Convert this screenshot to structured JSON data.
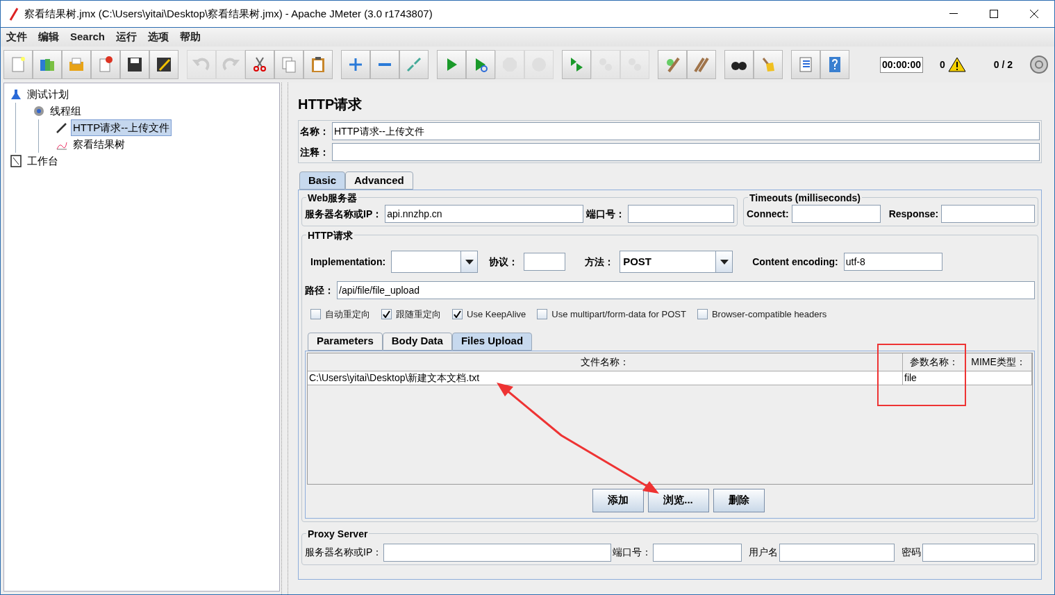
{
  "window": {
    "title": "察看结果树.jmx (C:\\Users\\yitai\\Desktop\\察看结果树.jmx) - Apache JMeter (3.0 r1743807)"
  },
  "menu": [
    "文件",
    "编辑",
    "Search",
    "运行",
    "选项",
    "帮助"
  ],
  "toolbar": [
    [
      {
        "kind": "new",
        "disabled": false
      },
      {
        "kind": "templates",
        "disabled": false
      },
      {
        "kind": "open",
        "disabled": false
      },
      {
        "kind": "close",
        "disabled": false
      },
      {
        "kind": "save",
        "disabled": false
      },
      {
        "kind": "save-as",
        "disabled": false
      }
    ],
    [
      {
        "kind": "undo",
        "disabled": true
      },
      {
        "kind": "redo",
        "disabled": true
      },
      {
        "kind": "cut",
        "disabled": false
      },
      {
        "kind": "copy",
        "disabled": false
      },
      {
        "kind": "paste",
        "disabled": false
      }
    ],
    [
      {
        "kind": "expand",
        "disabled": false
      },
      {
        "kind": "collapse",
        "disabled": false
      },
      {
        "kind": "toggle",
        "disabled": false
      }
    ],
    [
      {
        "kind": "start",
        "disabled": false
      },
      {
        "kind": "start-no-pause",
        "disabled": false
      },
      {
        "kind": "stop",
        "disabled": true
      },
      {
        "kind": "shutdown",
        "disabled": true
      }
    ],
    [
      {
        "kind": "remote-start",
        "disabled": false
      },
      {
        "kind": "remote-stop",
        "disabled": true
      },
      {
        "kind": "remote-shutdown",
        "disabled": true
      }
    ],
    [
      {
        "kind": "clear",
        "disabled": false
      },
      {
        "kind": "clear-all",
        "disabled": false
      }
    ],
    [
      {
        "kind": "search",
        "disabled": false
      },
      {
        "kind": "reset-search",
        "disabled": false
      }
    ],
    [
      {
        "kind": "function-helper",
        "disabled": false
      },
      {
        "kind": "help",
        "disabled": false
      }
    ]
  ],
  "status": {
    "timer": "00:00:00",
    "warnings": "0",
    "threads": "0 / 2"
  },
  "tree": [
    {
      "label": "测试计划",
      "kind": "plan",
      "selected": false,
      "children": [
        {
          "label": "线程组",
          "kind": "threads",
          "selected": false,
          "children": [
            {
              "label": "HTTP请求--上传文件",
              "kind": "sampler",
              "selected": true
            },
            {
              "label": "察看结果树",
              "kind": "listener",
              "selected": false
            }
          ]
        }
      ]
    },
    {
      "label": "工作台",
      "kind": "workbench",
      "selected": false
    }
  ],
  "editor": {
    "title": "HTTP请求",
    "name_label": "名称：",
    "name_value": "HTTP请求--上传文件",
    "comment_label": "注释：",
    "tabs": [
      {
        "label": "Basic",
        "selected": true
      },
      {
        "label": "Advanced",
        "selected": false
      }
    ],
    "web_server": {
      "title": "Web服务器",
      "server_label": "服务器名称或IP：",
      "server_value": "api.nnzhp.cn",
      "port_label": "端口号："
    },
    "timeouts": {
      "title": "Timeouts (milliseconds)",
      "connect_label": "Connect:",
      "response_label": "Response:"
    },
    "http_request": {
      "title": "HTTP请求",
      "implementation_label": "Implementation:",
      "protocol_label": "协议：",
      "method_label": "方法：",
      "method_value": "POST",
      "encoding_label": "Content encoding:",
      "encoding_value": "utf-8",
      "path_label": "路径：",
      "path_value": "/api/file/file_upload",
      "options": [
        {
          "label": "自动重定向",
          "checked": false
        },
        {
          "label": "跟随重定向",
          "checked": true
        },
        {
          "label": "Use KeepAlive",
          "checked": true
        },
        {
          "label": "Use multipart/form-data for POST",
          "checked": false
        },
        {
          "label": "Browser-compatible headers",
          "checked": false
        }
      ]
    },
    "sub_tabs": [
      {
        "label": "Parameters",
        "selected": false
      },
      {
        "label": "Body Data",
        "selected": false
      },
      {
        "label": "Files Upload",
        "selected": true
      }
    ],
    "files_table": {
      "columns": [
        "文件名称：",
        "参数名称：",
        "MIME类型："
      ],
      "rows": [
        [
          "C:\\Users\\yitai\\Desktop\\新建文本文档.txt",
          "file",
          ""
        ]
      ]
    },
    "buttons": [
      "添加",
      "浏览...",
      "删除"
    ],
    "proxy": {
      "title": "Proxy Server",
      "server_label": "服务器名称或IP：",
      "port_label": "端口号：",
      "user_label": "用户名",
      "password_label": "密码"
    }
  }
}
